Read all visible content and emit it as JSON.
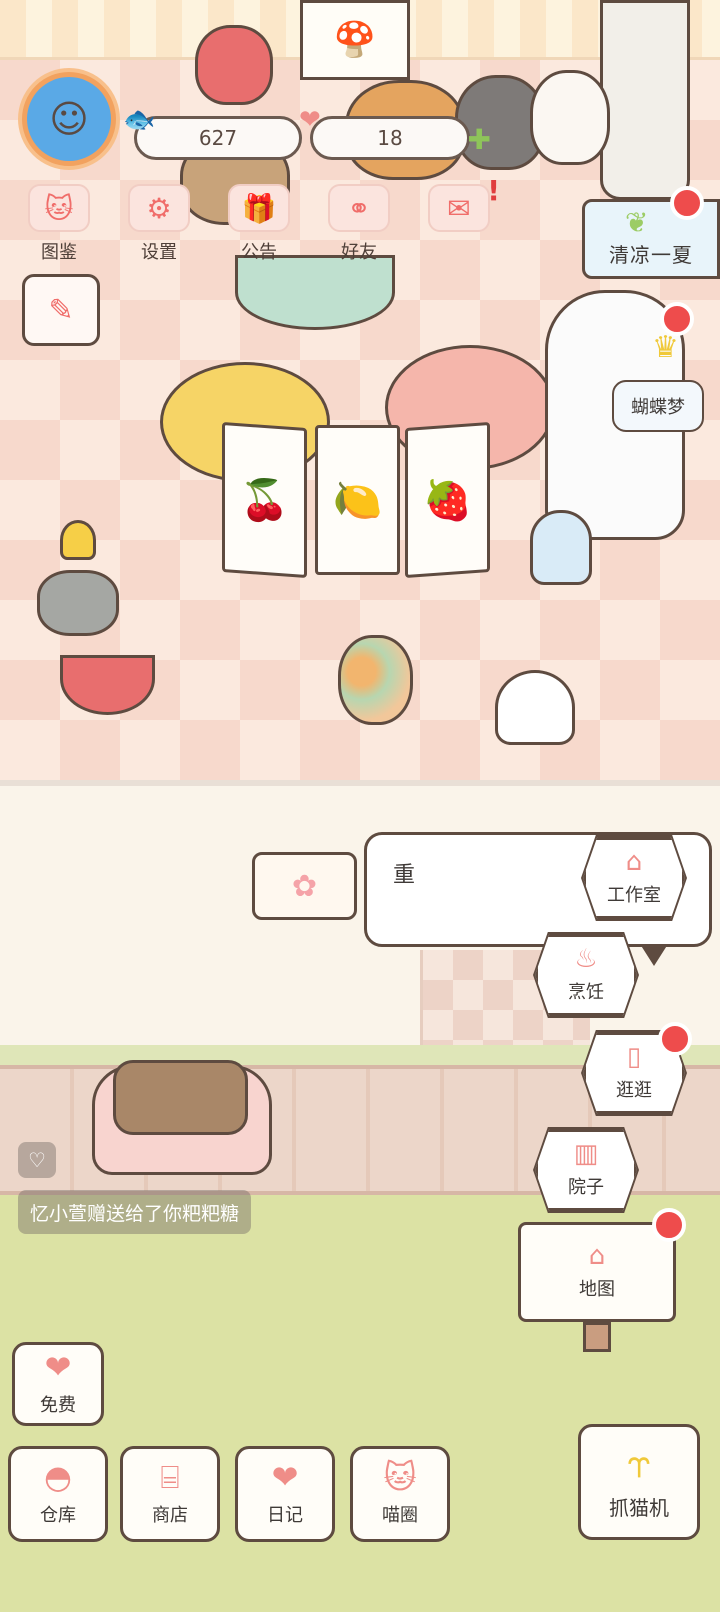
{
  "player": {
    "avatar_icon": "player-avatar-icon"
  },
  "currency": {
    "coins": "627",
    "coins_icon": "fish-icon",
    "hearts": "18",
    "hearts_icon": "heart-icon"
  },
  "top_menu": [
    {
      "label": "图鉴",
      "icon": "cat-book-icon"
    },
    {
      "label": "设置",
      "icon": "gear-icon"
    },
    {
      "label": "公告",
      "icon": "gift-icon"
    },
    {
      "label": "好友",
      "icon": "friends-icon"
    },
    {
      "label": "",
      "icon": "mail-icon",
      "alert": "!"
    }
  ],
  "event_banner": {
    "label": "清凉一夏"
  },
  "npc": {
    "name": "蝴蝶梦"
  },
  "speech_bubble": {
    "text": "重"
  },
  "right_nav": [
    {
      "label": "工作室",
      "icon": "hanger-icon"
    },
    {
      "label": "烹饪",
      "icon": "pot-icon"
    },
    {
      "label": "逛逛",
      "icon": "door-icon"
    },
    {
      "label": "院子",
      "icon": "fence-icon"
    }
  ],
  "map_sign": {
    "label": "地图",
    "icon": "house-icon"
  },
  "notification": {
    "text": "忆小萱赠送给了你粑粑糖"
  },
  "bottom_bar": {
    "free": "免费",
    "warehouse": "仓库",
    "shop": "商店",
    "diary": "日记",
    "meow_circle": "喵圈",
    "claw_machine": "抓猫机"
  },
  "colors": {
    "accent_pink": "#ef8d88",
    "alert_red": "#ee4c4c",
    "outline_brown": "#5e4b40",
    "lawn_green": "#dce2a4"
  }
}
